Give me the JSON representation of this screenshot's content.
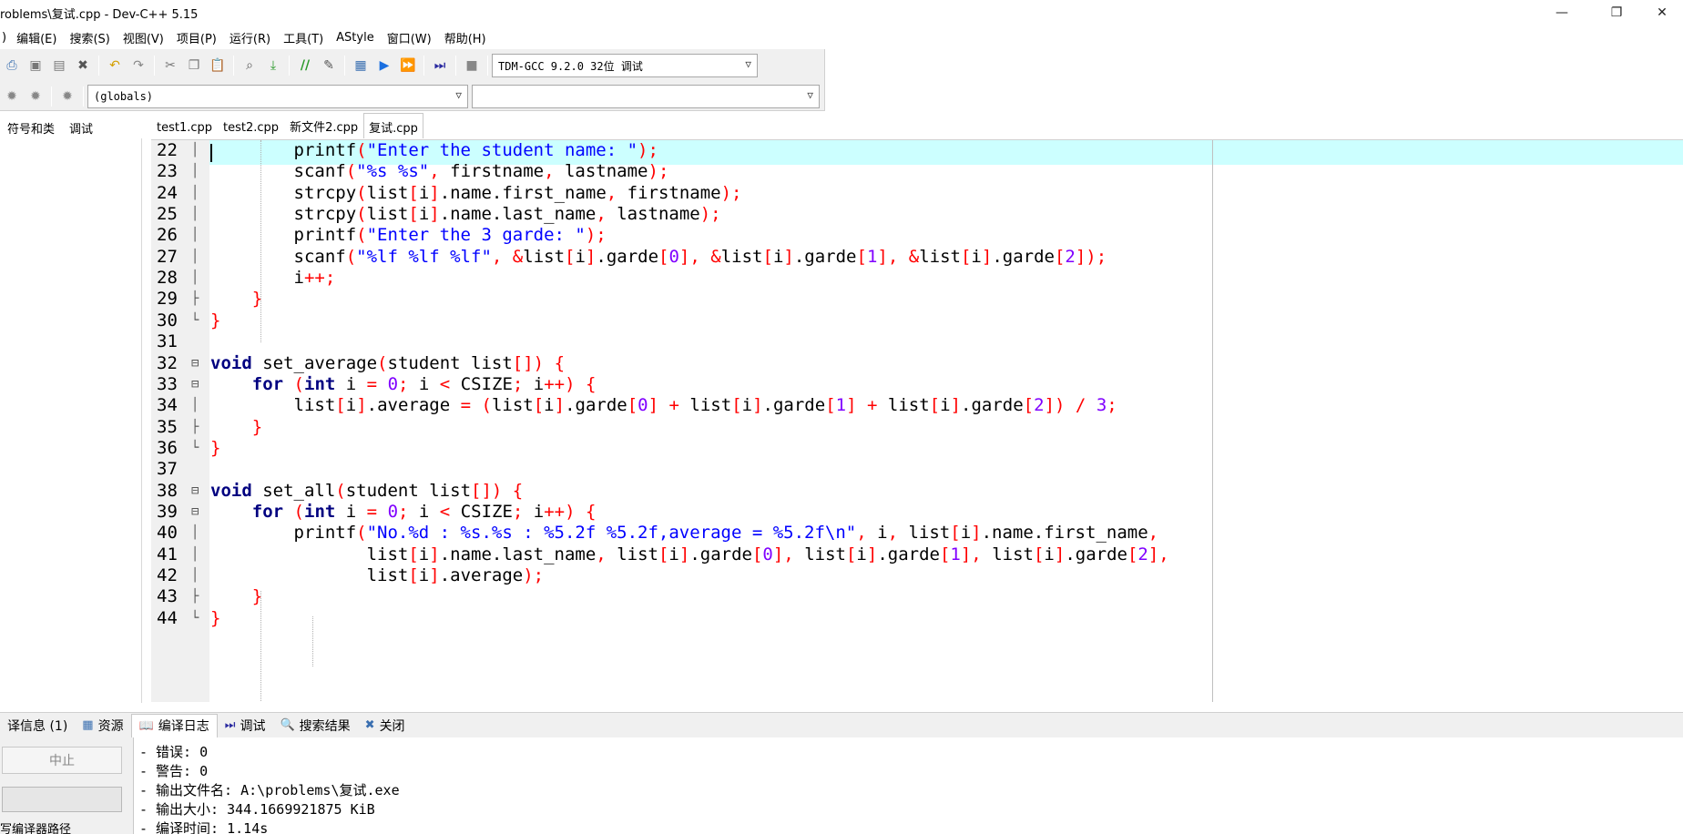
{
  "window": {
    "title": "roblems\\复试.cpp - Dev-C++ 5.15",
    "minimize_glyph": "—",
    "restore_glyph": "❐",
    "close_glyph": "✕"
  },
  "menu": {
    "items": [
      "编辑(E)",
      "搜索(S)",
      "视图(V)",
      "项目(P)",
      "运行(R)",
      "工具(T)",
      "AStyle",
      "窗口(W)",
      "帮助(H)"
    ]
  },
  "toolbar": {
    "compiler_select": "TDM-GCC 9.2.0 32位 调试",
    "scope_select": "(globals)",
    "member_select": ""
  },
  "left_panel": {
    "tabs": [
      "符号和类",
      "调试"
    ]
  },
  "editor": {
    "tabs": [
      {
        "label": "test1.cpp",
        "active": false
      },
      {
        "label": "test2.cpp",
        "active": false
      },
      {
        "label": "新文件2.cpp",
        "active": false
      },
      {
        "label": "复试.cpp",
        "active": true
      }
    ],
    "lines": [
      {
        "n": "22",
        "fold": "│",
        "html": "        <span class=\"kw\"></span>printf<span class=\"sym\">(</span><span class=\"str\">\"Enter the student name: \"</span><span class=\"sym\">);</span>"
      },
      {
        "n": "23",
        "fold": "│",
        "html": "        scanf<span class=\"sym\">(</span><span class=\"str\">\"%s %s\"</span><span class=\"sym\">,</span> firstname<span class=\"sym\">,</span> lastname<span class=\"sym\">);</span>"
      },
      {
        "n": "24",
        "fold": "│",
        "html": "        strcpy<span class=\"sym\">(</span>list<span class=\"sym\">[</span>i<span class=\"sym\">]</span>.name.first_name<span class=\"sym\">,</span> firstname<span class=\"sym\">);</span>"
      },
      {
        "n": "25",
        "fold": "│",
        "html": "        strcpy<span class=\"sym\">(</span>list<span class=\"sym\">[</span>i<span class=\"sym\">]</span>.name.last_name<span class=\"sym\">,</span> lastname<span class=\"sym\">);</span>"
      },
      {
        "n": "26",
        "fold": "│",
        "html": "        printf<span class=\"sym\">(</span><span class=\"str\">\"Enter the 3 garde: \"</span><span class=\"sym\">);</span>"
      },
      {
        "n": "27",
        "fold": "│",
        "html": "        scanf<span class=\"sym\">(</span><span class=\"str\">\"%lf %lf %lf\"</span><span class=\"sym\">,</span> <span class=\"sym\">&amp;</span>list<span class=\"sym\">[</span>i<span class=\"sym\">]</span>.garde<span class=\"sym\">[</span><span class=\"num\">0</span><span class=\"sym\">],</span> <span class=\"sym\">&amp;</span>list<span class=\"sym\">[</span>i<span class=\"sym\">]</span>.garde<span class=\"sym\">[</span><span class=\"num\">1</span><span class=\"sym\">],</span> <span class=\"sym\">&amp;</span>list<span class=\"sym\">[</span>i<span class=\"sym\">]</span>.garde<span class=\"sym\">[</span><span class=\"num\">2</span><span class=\"sym\">]);</span>"
      },
      {
        "n": "28",
        "fold": "│",
        "html": "        i<span class=\"sym\">++;</span>"
      },
      {
        "n": "29",
        "fold": "├",
        "html": "    <span class=\"sym\">}</span>"
      },
      {
        "n": "30",
        "fold": "└",
        "html": "<span class=\"sym\">}</span>"
      },
      {
        "n": "31",
        "fold": "",
        "html": ""
      },
      {
        "n": "32",
        "fold": "⊟",
        "html": "<span class=\"kw\">void</span> set_average<span class=\"sym\">(</span>student list<span class=\"sym\">[])</span> <span class=\"sym\">{</span>"
      },
      {
        "n": "33",
        "fold": "⊟",
        "html": "    <span class=\"kw\">for</span> <span class=\"sym\">(</span><span class=\"kw\">int</span> i <span class=\"sym\">=</span> <span class=\"num\">0</span><span class=\"sym\">;</span> i <span class=\"sym\">&lt;</span> CSIZE<span class=\"sym\">;</span> i<span class=\"sym\">++)</span> <span class=\"sym\">{</span>"
      },
      {
        "n": "34",
        "fold": "│",
        "html": "        list<span class=\"sym\">[</span>i<span class=\"sym\">]</span>.average <span class=\"sym\">=</span> <span class=\"sym\">(</span>list<span class=\"sym\">[</span>i<span class=\"sym\">]</span>.garde<span class=\"sym\">[</span><span class=\"num\">0</span><span class=\"sym\">]</span> <span class=\"sym\">+</span> list<span class=\"sym\">[</span>i<span class=\"sym\">]</span>.garde<span class=\"sym\">[</span><span class=\"num\">1</span><span class=\"sym\">]</span> <span class=\"sym\">+</span> list<span class=\"sym\">[</span>i<span class=\"sym\">]</span>.garde<span class=\"sym\">[</span><span class=\"num\">2</span><span class=\"sym\">])</span> <span class=\"sym\">/</span> <span class=\"num\">3</span><span class=\"sym\">;</span>"
      },
      {
        "n": "35",
        "fold": "├",
        "html": "    <span class=\"sym\">}</span>"
      },
      {
        "n": "36",
        "fold": "└",
        "html": "<span class=\"sym\">}</span>"
      },
      {
        "n": "37",
        "fold": "",
        "html": ""
      },
      {
        "n": "38",
        "fold": "⊟",
        "html": "<span class=\"kw\">void</span> set_all<span class=\"sym\">(</span>student list<span class=\"sym\">[])</span> <span class=\"sym\">{</span>"
      },
      {
        "n": "39",
        "fold": "⊟",
        "html": "    <span class=\"kw\">for</span> <span class=\"sym\">(</span><span class=\"kw\">int</span> i <span class=\"sym\">=</span> <span class=\"num\">0</span><span class=\"sym\">;</span> i <span class=\"sym\">&lt;</span> CSIZE<span class=\"sym\">;</span> i<span class=\"sym\">++)</span> <span class=\"sym\">{</span>"
      },
      {
        "n": "40",
        "fold": "│",
        "html": "        printf<span class=\"sym\">(</span><span class=\"str\">\"No.%d : %s.%s : %5.2f %5.2f,average = %5.2f\\n\"</span><span class=\"sym\">,</span> i<span class=\"sym\">,</span> list<span class=\"sym\">[</span>i<span class=\"sym\">]</span>.name.first_name<span class=\"sym\">,</span>"
      },
      {
        "n": "41",
        "fold": "│",
        "html": "               list<span class=\"sym\">[</span>i<span class=\"sym\">]</span>.name.last_name<span class=\"sym\">,</span> list<span class=\"sym\">[</span>i<span class=\"sym\">]</span>.garde<span class=\"sym\">[</span><span class=\"num\">0</span><span class=\"sym\">],</span> list<span class=\"sym\">[</span>i<span class=\"sym\">]</span>.garde<span class=\"sym\">[</span><span class=\"num\">1</span><span class=\"sym\">],</span> list<span class=\"sym\">[</span>i<span class=\"sym\">]</span>.garde<span class=\"sym\">[</span><span class=\"num\">2</span><span class=\"sym\">],</span>"
      },
      {
        "n": "42",
        "fold": "│",
        "html": "               list<span class=\"sym\">[</span>i<span class=\"sym\">]</span>.average<span class=\"sym\">);</span>"
      },
      {
        "n": "43",
        "fold": "├",
        "html": "    <span class=\"sym\">}</span>"
      },
      {
        "n": "44",
        "fold": "└",
        "html": "<span class=\"sym\">}</span>"
      }
    ]
  },
  "bottom": {
    "tabs": [
      {
        "icon": "",
        "label": "译信息 (1)",
        "active": false
      },
      {
        "icon": "▦",
        "label": "资源",
        "active": false
      },
      {
        "icon": "📖",
        "label": "编译日志",
        "active": true
      },
      {
        "icon": "⏭",
        "label": "调试",
        "active": false
      },
      {
        "icon": "🔍",
        "label": "搜索结果",
        "active": false
      },
      {
        "icon": "✖",
        "label": "关闭",
        "active": false
      }
    ],
    "stop_label": "中止",
    "compiler_path_label": "写编译器路径",
    "log_lines": [
      "- 错误: 0",
      "- 警告: 0",
      "- 输出文件名: A:\\problems\\复试.exe",
      "- 输出大小: 344.1669921875 KiB",
      "- 编译时间: 1.14s"
    ]
  },
  "colors": {
    "keyword": "#000080",
    "string": "#0000ff",
    "number": "#8000ff",
    "symbol": "#ff0000",
    "current_line": "#ccffff"
  }
}
